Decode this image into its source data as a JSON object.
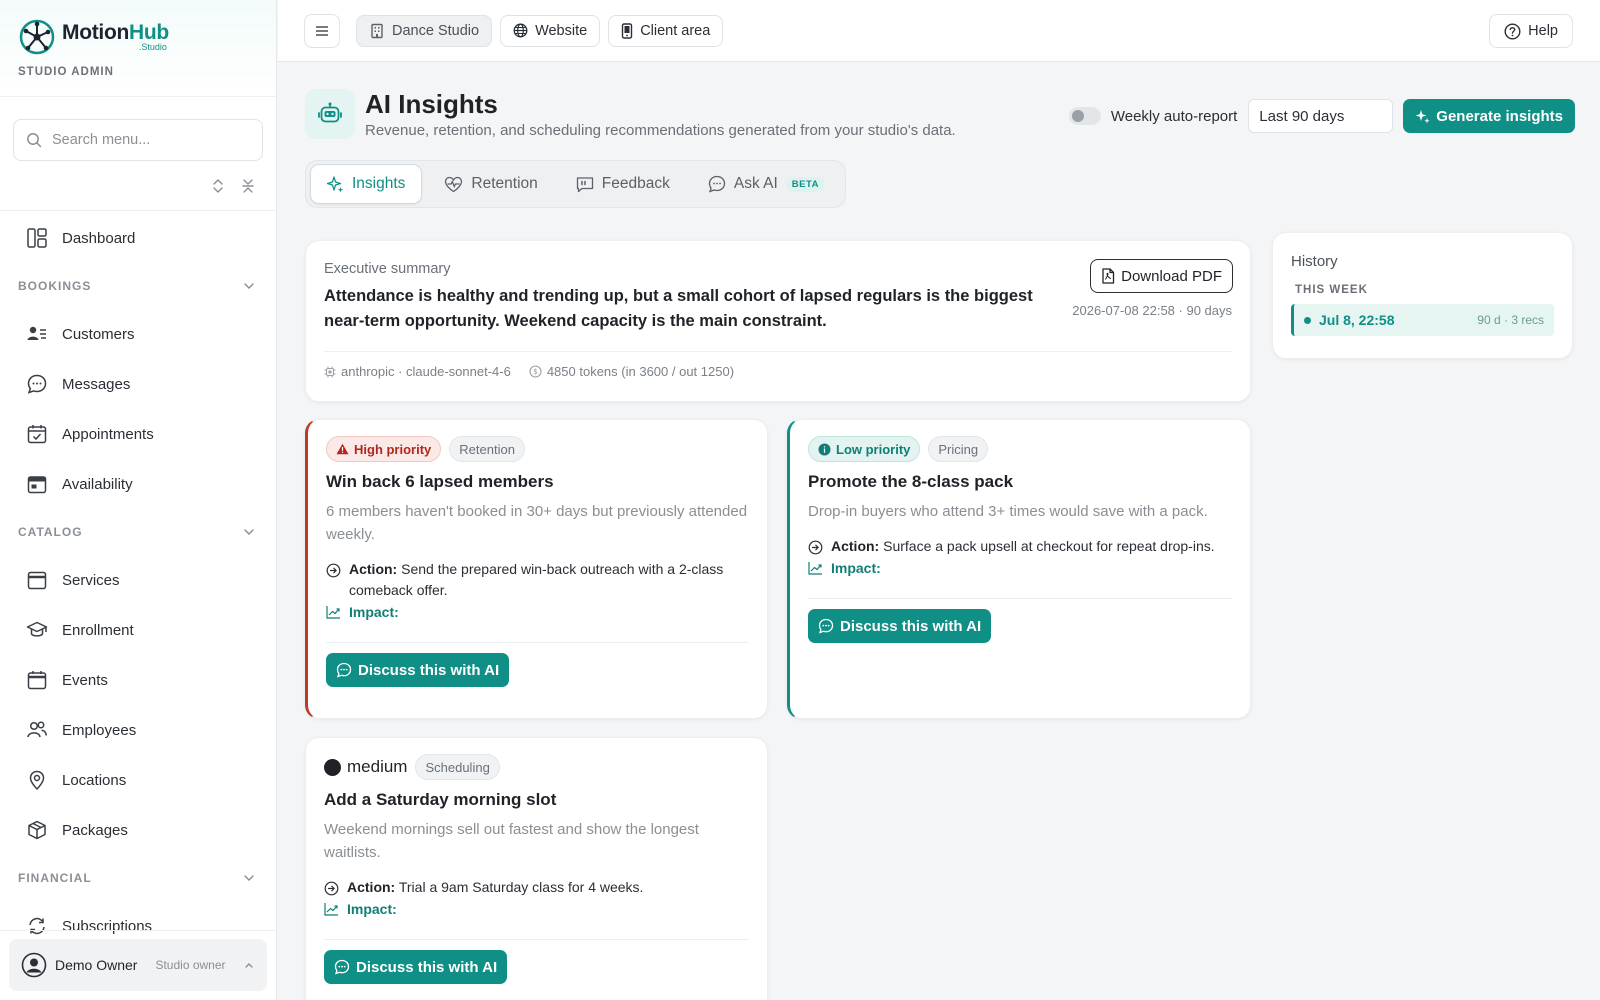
{
  "brand": {
    "name_a": "Motion",
    "name_b": "Hub",
    "sub": ".Studio",
    "role": "STUDIO ADMIN"
  },
  "sidebar": {
    "search_placeholder": "Search menu...",
    "dashboard": "Dashboard",
    "sections": {
      "bookings": "BOOKINGS",
      "catalog": "CATALOG",
      "financial": "FINANCIAL"
    },
    "bookings_items": [
      "Customers",
      "Messages",
      "Appointments",
      "Availability"
    ],
    "catalog_items": [
      "Services",
      "Enrollment",
      "Events",
      "Employees",
      "Locations",
      "Packages"
    ],
    "financial_items": [
      "Subscriptions"
    ],
    "user": {
      "name": "Demo Owner",
      "role": "Studio owner"
    }
  },
  "topbar": {
    "studio": "Dance Studio",
    "website": "Website",
    "client_area": "Client area",
    "help": "Help"
  },
  "page": {
    "title": "AI Insights",
    "subtitle": "Revenue, retention, and scheduling recommendations generated from your studio's data.",
    "auto_report_label": "Weekly auto-report",
    "range": "Last 90 days",
    "generate": "Generate insights"
  },
  "tabs": [
    {
      "label": "Insights"
    },
    {
      "label": "Retention"
    },
    {
      "label": "Feedback"
    },
    {
      "label": "Ask AI",
      "badge": "BETA"
    }
  ],
  "summary": {
    "label": "Executive summary",
    "text": "Attendance is healthy and trending up, but a small cohort of lapsed regulars is the biggest near-term opportunity. Weekend capacity is the main constraint.",
    "download": "Download PDF",
    "meta": "2026-07-08 22:58 · 90 days",
    "model": "anthropic · claude-sonnet-4-6",
    "tokens": "4850 tokens (in 3600 / out 1250)"
  },
  "history": {
    "title": "History",
    "group": "THIS WEEK",
    "item": {
      "date": "Jul 8, 22:58",
      "meta": "90 d · 3 recs"
    }
  },
  "recommendations": [
    {
      "priority": "High priority",
      "category": "Retention",
      "title": "Win back 6 lapsed members",
      "desc": "6 members haven't booked in 30+ days but previously attended weekly.",
      "action_label": "Action:",
      "action": "Send the prepared win-back outreach with a 2-class comeback offer.",
      "impact_label": "Impact:",
      "discuss": "Discuss this with AI"
    },
    {
      "priority": "Low priority",
      "category": "Pricing",
      "title": "Promote the 8-class pack",
      "desc": "Drop-in buyers who attend 3+ times would save with a pack.",
      "action_label": "Action:",
      "action": "Surface a pack upsell at checkout for repeat drop-ins.",
      "impact_label": "Impact:",
      "discuss": "Discuss this with AI"
    },
    {
      "priority": "medium",
      "category": "Scheduling",
      "title": "Add a Saturday morning slot",
      "desc": "Weekend mornings sell out fastest and show the longest waitlists.",
      "action_label": "Action:",
      "action": "Trial a 9am Saturday class for 4 weeks.",
      "impact_label": "Impact:",
      "discuss": "Discuss this with AI"
    }
  ],
  "colors": {
    "accent": "#0f8f86",
    "high": "#c0392b"
  }
}
